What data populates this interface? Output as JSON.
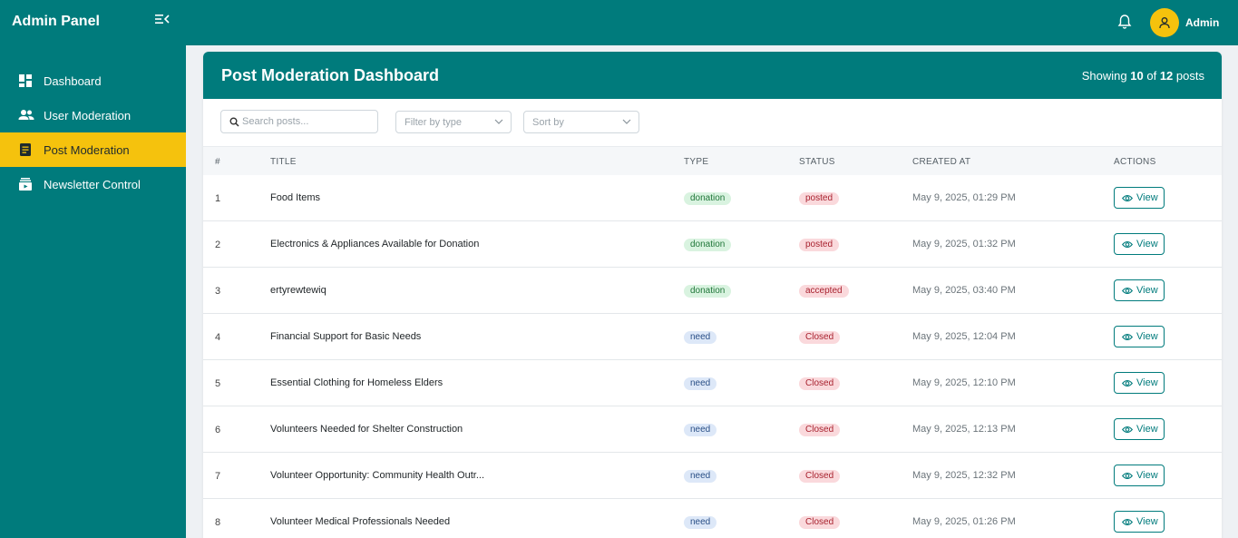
{
  "app": {
    "brand": "Admin Panel",
    "user": "Admin"
  },
  "sidebar": {
    "items": [
      {
        "label": "Dashboard",
        "icon": "dashboard-icon",
        "active": false
      },
      {
        "label": "User Moderation",
        "icon": "users-icon",
        "active": false
      },
      {
        "label": "Post Moderation",
        "icon": "document-icon",
        "active": true
      },
      {
        "label": "Newsletter Control",
        "icon": "newsletter-icon",
        "active": false
      }
    ]
  },
  "page": {
    "title": "Post Moderation Dashboard",
    "showing_prefix": "Showing",
    "showing_count": "10",
    "showing_of": "of",
    "showing_total": "12",
    "showing_suffix": "posts"
  },
  "filters": {
    "search_placeholder": "Search posts...",
    "type_placeholder": "Filter by type",
    "sort_placeholder": "Sort by"
  },
  "table": {
    "columns": [
      "#",
      "TITLE",
      "TYPE",
      "STATUS",
      "CREATED AT",
      "ACTIONS"
    ],
    "action_label": "View",
    "rows": [
      {
        "num": "1",
        "title": "Food Items",
        "type": "donation",
        "status": "posted",
        "created": "May 9, 2025, 01:29 PM"
      },
      {
        "num": "2",
        "title": "Electronics & Appliances Available for Donation",
        "type": "donation",
        "status": "posted",
        "created": "May 9, 2025, 01:32 PM"
      },
      {
        "num": "3",
        "title": "ertyrewtewiq",
        "type": "donation",
        "status": "accepted",
        "created": "May 9, 2025, 03:40 PM"
      },
      {
        "num": "4",
        "title": "Financial Support for Basic Needs",
        "type": "need",
        "status": "Closed",
        "created": "May 9, 2025, 12:04 PM"
      },
      {
        "num": "5",
        "title": "Essential Clothing for Homeless Elders",
        "type": "need",
        "status": "Closed",
        "created": "May 9, 2025, 12:10 PM"
      },
      {
        "num": "6",
        "title": "Volunteers Needed for Shelter Construction",
        "type": "need",
        "status": "Closed",
        "created": "May 9, 2025, 12:13 PM"
      },
      {
        "num": "7",
        "title": "Volunteer Opportunity: Community Health Outr...",
        "type": "need",
        "status": "Closed",
        "created": "May 9, 2025, 12:32 PM"
      },
      {
        "num": "8",
        "title": "Volunteer Medical Professionals Needed",
        "type": "need",
        "status": "Closed",
        "created": "May 9, 2025, 01:26 PM"
      }
    ]
  },
  "colors": {
    "primary": "#007b7c",
    "accent": "#f5c20d",
    "background": "#eef1f4"
  }
}
